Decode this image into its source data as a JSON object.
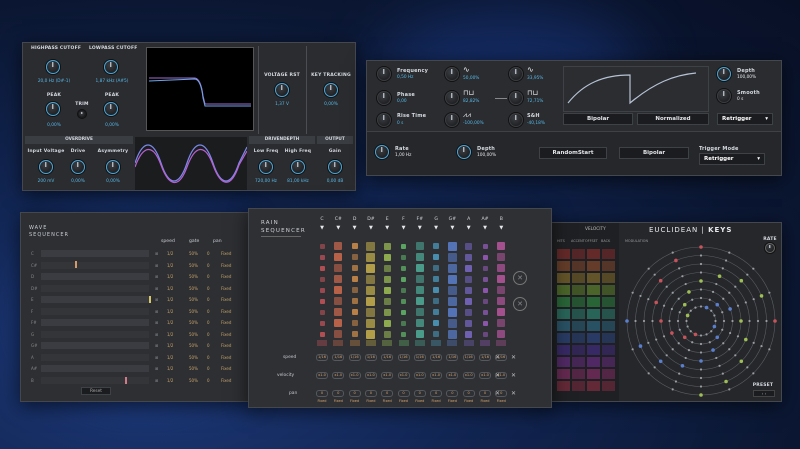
{
  "filter_panel": {
    "knobs": [
      {
        "label": "HIGHPASS CUTOFF",
        "value": "20,0 Hz (D#-1)"
      },
      {
        "label": "LOWPASS CUTOFF",
        "value": "1,87 kHz (A#5)"
      },
      {
        "label": "PEAK",
        "value": "0,00%"
      },
      {
        "label": "PEAK",
        "value": "0,00%"
      },
      {
        "label": "TRIM",
        "value": ""
      },
      {
        "label": "VOLTAGE RST",
        "value": "1,37 V"
      },
      {
        "label": "KEY TRACKING",
        "value": "0,00%"
      }
    ],
    "sections": [
      "OVERDRIVE",
      "DRIVENDEPTH",
      "OUTPUT"
    ],
    "bottom_knobs": [
      {
        "label": "Input Voltage",
        "value": "200 mV"
      },
      {
        "label": "Drive",
        "value": "0,00%"
      },
      {
        "label": "Asymmetry",
        "value": "0,00%"
      },
      {
        "label": "Low Freq",
        "value": "720,00 Hz"
      },
      {
        "label": "High Freq",
        "value": "81,00 kHz"
      },
      {
        "label": "Gain",
        "value": "0,00 dB"
      }
    ]
  },
  "lfo_panel": {
    "knobs": [
      {
        "label": "Frequency",
        "value": "0,50 Hz"
      },
      {
        "label": "Phase",
        "value": "0,00"
      },
      {
        "label": "Rise Time",
        "value": "0 s"
      },
      {
        "label": "Depth",
        "value": "100,00%"
      },
      {
        "label": "Smooth",
        "value": "0 s"
      }
    ],
    "shapes": [
      {
        "value": "50,00%"
      },
      {
        "value": "33,95%"
      },
      {
        "value": "82,82%"
      },
      {
        "value": "72,71%"
      },
      {
        "value": "-100,00%"
      },
      {
        "label": "S&H",
        "value": "-40,18%"
      }
    ],
    "buttons": [
      "Bipolar",
      "Normalized"
    ],
    "dropdown": "Retrigger",
    "bottom": {
      "rate": {
        "label": "Rate",
        "value": "1,00 Hz"
      },
      "depth": {
        "label": "Depth",
        "value": "100,00%"
      },
      "random_start": "RandomStart",
      "bipolar": "Bipolar",
      "trigger_mode_label": "Trigger Mode",
      "trigger_mode": "Retrigger"
    }
  },
  "wave_sequencer": {
    "title": "WAVE SEQUENCER",
    "columns": [
      "speed",
      "gate",
      "pan"
    ],
    "rows": [
      {
        "note": "C",
        "speed": "1/2",
        "gate": "50%",
        "pan": "0",
        "mode": "Fixed"
      },
      {
        "note": "C#",
        "speed": "1/2",
        "gate": "50%",
        "pan": "0",
        "mode": "Fixed"
      },
      {
        "note": "D",
        "speed": "1/2",
        "gate": "50%",
        "pan": "0",
        "mode": "Fixed"
      },
      {
        "note": "D#",
        "speed": "1/2",
        "gate": "50%",
        "pan": "0",
        "mode": "Fixed"
      },
      {
        "note": "E",
        "speed": "1/2",
        "gate": "50%",
        "pan": "0",
        "mode": "Fixed"
      },
      {
        "note": "F",
        "speed": "1/2",
        "gate": "50%",
        "pan": "0",
        "mode": "Fixed"
      },
      {
        "note": "F#",
        "speed": "1/2",
        "gate": "50%",
        "pan": "0",
        "mode": "Fixed"
      },
      {
        "note": "G",
        "speed": "1/2",
        "gate": "50%",
        "pan": "0",
        "mode": "Fixed"
      },
      {
        "note": "G#",
        "speed": "1/2",
        "gate": "50%",
        "pan": "0",
        "mode": "Fixed"
      },
      {
        "note": "A",
        "speed": "1/2",
        "gate": "50%",
        "pan": "0",
        "mode": "Fixed"
      },
      {
        "note": "A#",
        "speed": "1/2",
        "gate": "50%",
        "pan": "0",
        "mode": "Fixed"
      },
      {
        "note": "B",
        "speed": "1/2",
        "gate": "50%",
        "pan": "0",
        "mode": "Fixed"
      }
    ],
    "button": "Reset"
  },
  "rain_sequencer": {
    "title": "RAIN SEQUENCER",
    "notes": [
      "C",
      "C#",
      "D",
      "D#",
      "E",
      "F",
      "F#",
      "G",
      "G#",
      "A",
      "A#",
      "B"
    ],
    "colors": [
      "#c8535b",
      "#d06a4e",
      "#d08d4a",
      "#c9b24c",
      "#9fbf55",
      "#62b86a",
      "#4fae9a",
      "#4c9ec4",
      "#5b7fcf",
      "#7a68c8",
      "#9a5cbf",
      "#b8569f"
    ],
    "speed_label": "speed",
    "speed_values": [
      "1/16",
      "1/16",
      "1/16",
      "1/16",
      "1/16",
      "1/16",
      "1/16",
      "1/16",
      "1/16",
      "1/16",
      "1/16",
      "1/16"
    ],
    "velocity_label": "velocity",
    "velocity_values": [
      "x1.0",
      "x1.0",
      "x1.0",
      "x1.0",
      "x1.0",
      "x1.0",
      "x1.0",
      "x1.0",
      "x1.0",
      "x1.0",
      "x1.0",
      "x1.0"
    ],
    "pan_label": "pan",
    "pan_values": [
      "0",
      "0",
      "0",
      "0",
      "0",
      "0",
      "0",
      "0",
      "0",
      "0",
      "0",
      "0"
    ],
    "pan_modes": [
      "Fixed",
      "Fixed",
      "Fixed",
      "Fixed",
      "Fixed",
      "Fixed",
      "Fixed",
      "Fixed",
      "Fixed",
      "Fixed",
      "Fixed",
      "Fixed"
    ]
  },
  "euclidean": {
    "title": "EUCLIDEAN",
    "title_accent": "KEYS",
    "tabs": [
      "VELOCITY"
    ],
    "col_headers": [
      "HITS",
      "ACCENT",
      "OFFSET",
      "BACK",
      "MODULATION"
    ],
    "rate_label": "RATE",
    "preset_label": "PRESET"
  }
}
